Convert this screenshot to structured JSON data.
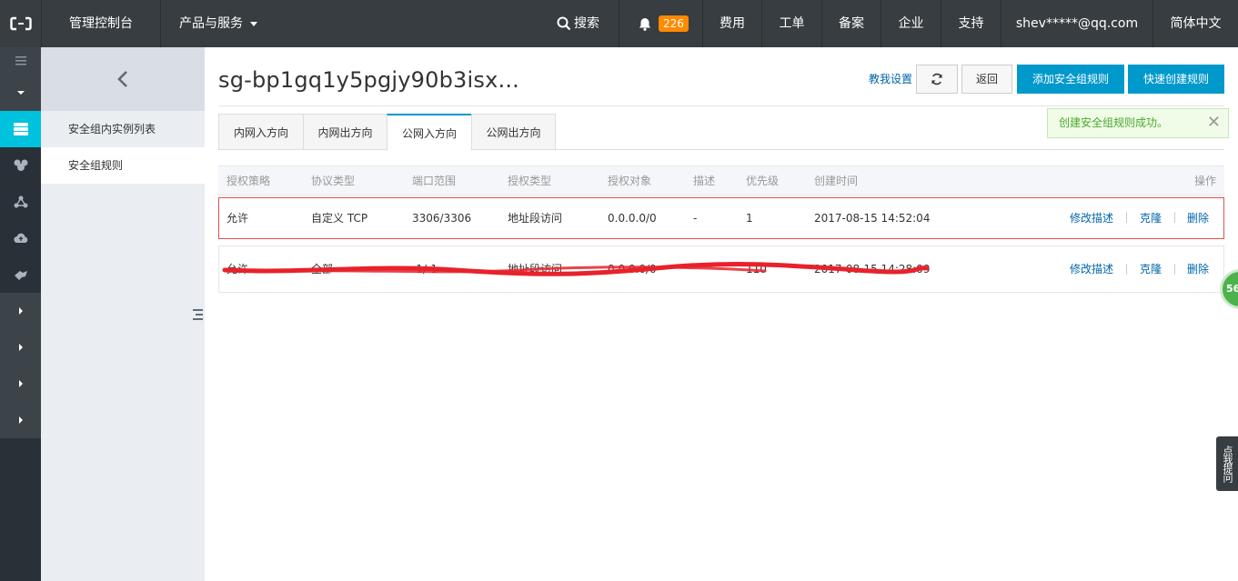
{
  "topbar": {
    "console": "管理控制台",
    "products": "产品与服务",
    "search": "搜索",
    "notification_count": "226",
    "fees": "费用",
    "tickets": "工单",
    "icp": "备案",
    "enterprise": "企业",
    "support": "支持",
    "account": "shev*****@qq.com",
    "language": "简体中文"
  },
  "sidebar": {
    "items": [
      {
        "label": "安全组内实例列表"
      },
      {
        "label": "安全组规则"
      }
    ]
  },
  "header": {
    "title": "sg-bp1gq1y5pgjy90b3isx...",
    "help_link": "教我设置",
    "back_button": "返回",
    "add_rule_button": "添加安全组规则",
    "quick_create_button": "快速创建规则"
  },
  "tabs": [
    {
      "label": "内网入方向"
    },
    {
      "label": "内网出方向"
    },
    {
      "label": "公网入方向"
    },
    {
      "label": "公网出方向"
    }
  ],
  "toast": {
    "message": "创建安全组规则成功。"
  },
  "table": {
    "headers": [
      "授权策略",
      "协议类型",
      "端口范围",
      "授权类型",
      "授权对象",
      "描述",
      "优先级",
      "创建时间",
      "操作"
    ],
    "rows": [
      {
        "policy": "允许",
        "protocol": "自定义 TCP",
        "port": "3306/3306",
        "auth_type": "地址段访问",
        "auth_object": "0.0.0.0/0",
        "description": "-",
        "priority": "1",
        "created": "2017-08-15 14:52:04",
        "actions": [
          "修改描述",
          "克隆",
          "删除"
        ]
      },
      {
        "policy": "允许",
        "protocol": "全部",
        "port": "-1/-1",
        "auth_type": "地址段访问",
        "auth_object": "0.0.0.0/0",
        "description": "",
        "priority": "110",
        "created": "2017-08-15 14:28:09",
        "actions": [
          "修改描述",
          "克隆",
          "删除"
        ]
      }
    ]
  },
  "float_badge": "56",
  "feedback": "点我提问",
  "colors": {
    "topbar": "#373d41",
    "accent": "#0099cc",
    "link": "#0066aa",
    "highlight_border": "#d9534f",
    "scribble": "#e8222a"
  }
}
